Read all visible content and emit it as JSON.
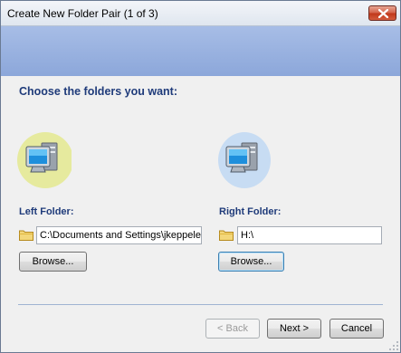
{
  "window": {
    "title": "Create New Folder Pair (1 of 3)"
  },
  "main": {
    "heading": "Choose the folders you want:"
  },
  "left": {
    "label": "Left Folder:",
    "path": "C:\\Documents and Settings\\jkeppeler",
    "browse_label": "Browse..."
  },
  "right": {
    "label": "Right Folder:",
    "path": "H:\\",
    "browse_label": "Browse..."
  },
  "footer": {
    "back_label": "< Back",
    "next_label": "Next >",
    "cancel_label": "Cancel"
  },
  "icons": {
    "computer": "computer-icon",
    "folder": "folder-icon",
    "close": "close-icon",
    "grip": "resize-grip-icon"
  },
  "colors": {
    "banner": "#8ca7da",
    "heading": "#1f3b7a",
    "left_highlight": "#e6ea9e",
    "right_highlight": "#c7dcf3"
  }
}
